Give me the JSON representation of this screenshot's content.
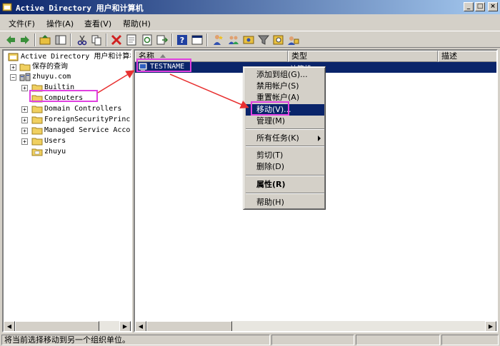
{
  "window": {
    "title": "Active Directory 用户和计算机",
    "minimize": "_",
    "maximize": "□",
    "close": "×"
  },
  "menu": [
    "文件(F)",
    "操作(A)",
    "查看(V)",
    "帮助(H)"
  ],
  "toolbar": {
    "icons": [
      "back-icon",
      "forward-icon",
      "up-folder-icon",
      "show-tree-icon",
      "cut-icon",
      "copy-icon",
      "delete-icon",
      "properties-icon",
      "refresh-icon",
      "export-list-icon",
      "help-icon",
      "console-icon",
      "new-user-icon",
      "new-group-icon",
      "filter-icon",
      "add-to-group-icon",
      "find-icon"
    ]
  },
  "tree": {
    "root": "Active Directory 用户和计算机",
    "saved_queries": "保存的查询",
    "domain": "zhuyu.com",
    "children": [
      "Builtin",
      "Computers",
      "Domain Controllers",
      "ForeignSecurityPrincip",
      "Managed Service Accour",
      "Users",
      "zhuyu"
    ]
  },
  "list": {
    "columns": [
      "名称",
      "类型",
      "描述"
    ],
    "rows": [
      {
        "name": "TESTNAME",
        "type": "计算机",
        "description": ""
      }
    ]
  },
  "context_menu": {
    "items": [
      "添加到组(G)...",
      "禁用帐户(S)",
      "重置帐户(A)",
      "移动(V)...",
      "管理(M)",
      "所有任务(K)",
      "剪切(T)",
      "删除(D)",
      "属性(R)",
      "帮助(H)"
    ]
  },
  "status": {
    "text": "将当前选择移动到另一个组织单位。"
  },
  "colors": {
    "selection": "#0a246a",
    "annotation": "#e040e0",
    "arrow": "#e83030"
  }
}
